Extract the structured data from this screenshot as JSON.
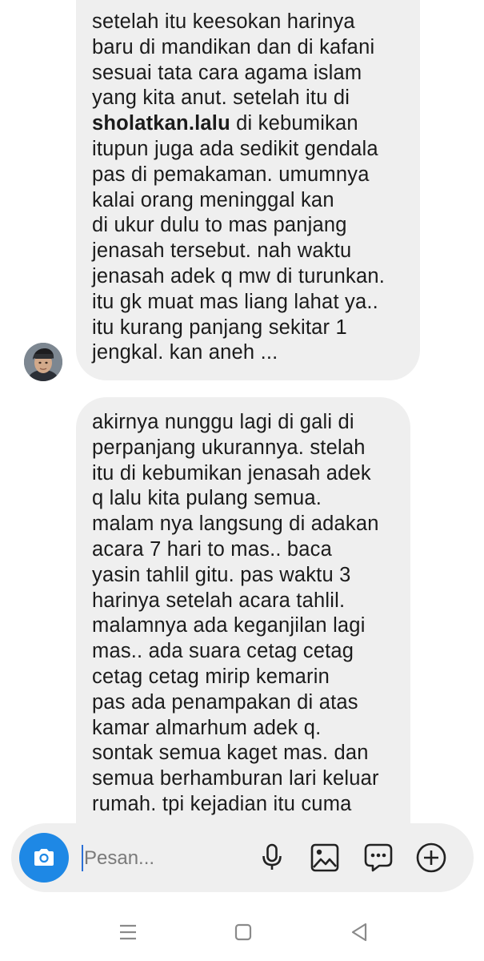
{
  "messages": [
    {
      "sender": "incoming",
      "lines": [
        {
          "text": " setelah itu keesokan harinya"
        },
        {
          "text": "baru di mandikan dan di kafani"
        },
        {
          "text": "sesuai tata cara agama islam"
        },
        {
          "text": "yang kita anut. setelah itu di"
        },
        {
          "bold": "sholatkan.lalu",
          "text": " di kebumikan"
        },
        {
          "text": "itupun juga ada sedikit gendala"
        },
        {
          "text": "pas di pemakaman. umumnya"
        },
        {
          "text": "kalai orang meninggal kan"
        },
        {
          "text": "di ukur dulu to mas panjang"
        },
        {
          "text": "jenasah tersebut. nah waktu"
        },
        {
          "text": "jenasah adek q mw di turunkan."
        },
        {
          "text": "itu gk muat mas liang lahat ya.."
        },
        {
          "text": "itu kurang panjang sekitar 1"
        },
        {
          "text": "jengkal. kan aneh ..."
        }
      ]
    },
    {
      "sender": "incoming",
      "lines": [
        {
          "text": "akirnya nunggu lagi di gali di"
        },
        {
          "text": "perpanjang ukurannya. stelah"
        },
        {
          "text": "itu di kebumikan jenasah adek"
        },
        {
          "text": "q lalu kita pulang semua."
        },
        {
          "text": "malam nya langsung di adakan"
        },
        {
          "text": "acara 7 hari to mas.. baca"
        },
        {
          "text": "yasin tahlil gitu. pas waktu 3"
        },
        {
          "text": "harinya setelah acara tahlil."
        },
        {
          "text": "malamnya ada keganjilan lagi"
        },
        {
          "text": "mas.. ada suara cetag cetag"
        },
        {
          "text": "cetag cetag mirip kemarin"
        },
        {
          "text": "pas ada penampakan di atas"
        },
        {
          "text": "kamar almarhum adek q."
        },
        {
          "text": "sontak semua kaget mas. dan"
        },
        {
          "text": "semua berhamburan lari keluar"
        },
        {
          "text": "rumah. tpi kejadian itu cuma"
        }
      ]
    }
  ],
  "composer": {
    "placeholder": "Pesan...",
    "value": "",
    "icons": [
      "camera-icon",
      "microphone-icon",
      "gallery-icon",
      "sticker-chat-icon",
      "add-icon"
    ]
  },
  "navigation": {
    "icons": [
      "recent-apps-icon",
      "home-icon",
      "back-icon"
    ]
  },
  "colors": {
    "bubble": "#efefef",
    "accent": "#1e88e5",
    "icon": "#222222",
    "nav_icon": "#8a8a8a"
  }
}
